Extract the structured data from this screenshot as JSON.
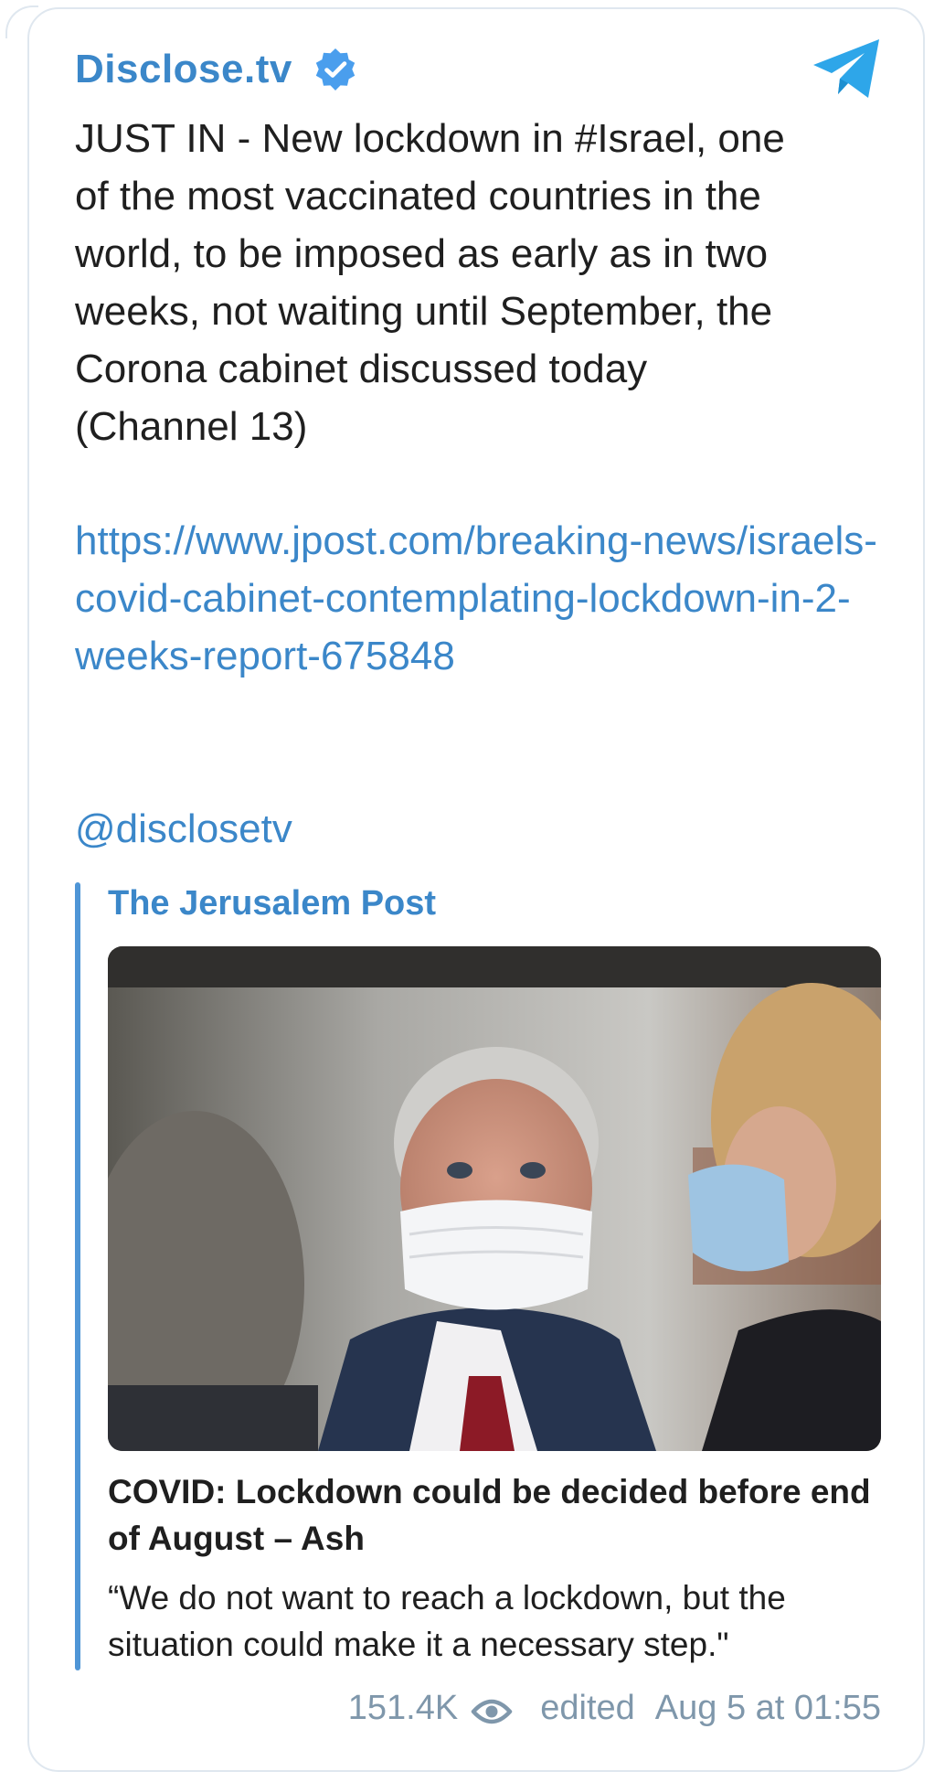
{
  "channel": {
    "name": "Disclose.tv",
    "verified_icon": "verified-badge-icon",
    "app_icon": "telegram-logo-icon"
  },
  "post": {
    "text": "JUST IN - New lockdown in #Israel, one\nof the most vaccinated countries in the\nworld, to be imposed as early as in two\nweeks, not waiting until September, the\nCorona cabinet discussed today\n(Channel 13)",
    "link": "https://www.jpost.com/breaking-news/israels-covid-cabinet-contemplating-lockdown-in-2-weeks-report-675848",
    "mention": "@disclosetv"
  },
  "link_preview": {
    "site_name": "The Jerusalem Post",
    "title": "COVID: Lockdown could be decided before end of August – Ash",
    "description": "“We do not want to reach a lockdown, but the situation could make it a necessary step.\""
  },
  "meta": {
    "views": "151.4K",
    "views_icon": "eye-icon",
    "edited_label": "edited",
    "timestamp": "Aug 5 at 01:55"
  },
  "colors": {
    "accent": "#3b87c9",
    "verified": "#4a9eed",
    "telegram": "#2ea6e9",
    "meta": "#7f97ab",
    "text": "#1f1f1f"
  }
}
